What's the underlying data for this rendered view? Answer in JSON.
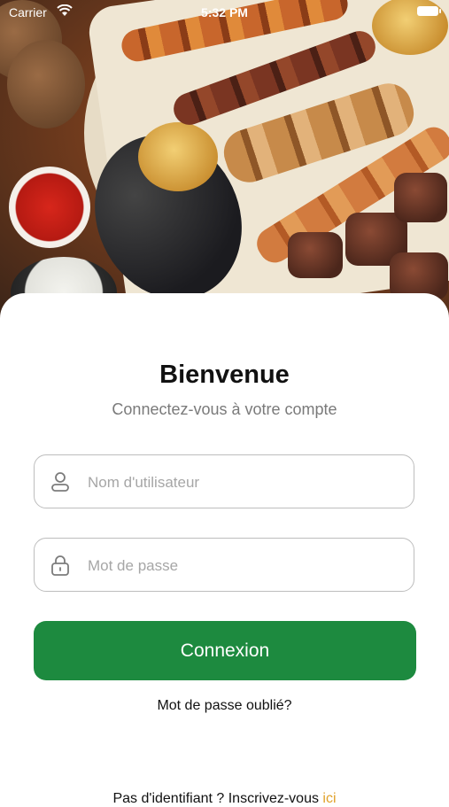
{
  "status_bar": {
    "carrier": "Carrier",
    "time": "5:32 PM"
  },
  "hero": {
    "image": "grilled-meat-platter"
  },
  "login": {
    "title": "Bienvenue",
    "subtitle": "Connectez-vous à votre compte",
    "username_placeholder": "Nom d'utilisateur",
    "username_value": "",
    "password_placeholder": "Mot de passe",
    "password_value": "",
    "submit_label": "Connexion",
    "forgot_label": "Mot de passe oublié?",
    "signup_prefix": "Pas d'identifiant ? Inscrivez-vous",
    "signup_link": "ici"
  },
  "colors": {
    "primary": "#1d8a3f",
    "link": "#e0a12a"
  }
}
